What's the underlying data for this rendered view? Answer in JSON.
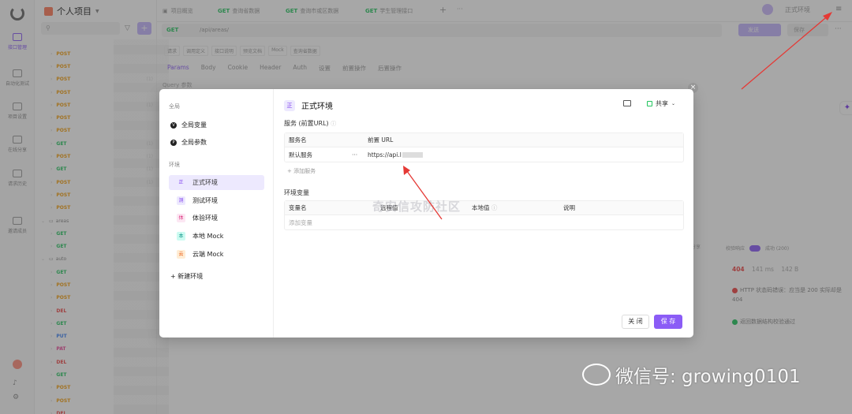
{
  "app": {
    "project_title": "个人项目",
    "nav": [
      {
        "label": "接口管理"
      },
      {
        "label": "自动化测试"
      },
      {
        "label": "项目设置"
      },
      {
        "label": "在线分享"
      },
      {
        "label": "请求历史"
      },
      {
        "label": "邀请成员"
      }
    ],
    "tree": [
      {
        "method": "POST",
        "cls": "m-post",
        "count": ""
      },
      {
        "method": "POST",
        "cls": "m-post",
        "count": ""
      },
      {
        "method": "POST",
        "cls": "m-post",
        "count": "(1)"
      },
      {
        "method": "POST",
        "cls": "m-post",
        "count": ""
      },
      {
        "method": "POST",
        "cls": "m-post",
        "count": "(1)"
      },
      {
        "method": "POST",
        "cls": "m-post",
        "count": ""
      },
      {
        "method": "POST",
        "cls": "m-post",
        "count": ""
      },
      {
        "method": "GET",
        "cls": "m-get",
        "count": "(1)"
      },
      {
        "method": "POST",
        "cls": "m-post",
        "count": "(1)"
      },
      {
        "method": "GET",
        "cls": "m-get",
        "count": "(1)"
      },
      {
        "method": "POST",
        "cls": "m-post",
        "count": "(1)"
      },
      {
        "method": "POST",
        "cls": "m-post",
        "count": ""
      },
      {
        "method": "POST",
        "cls": "m-post",
        "count": ""
      },
      {
        "folder": "areas"
      },
      {
        "method": "GET",
        "cls": "m-get",
        "count": ""
      },
      {
        "method": "GET",
        "cls": "m-get",
        "count": ""
      },
      {
        "folder": "auto"
      },
      {
        "method": "GET",
        "cls": "m-get",
        "count": ""
      },
      {
        "method": "POST",
        "cls": "m-post",
        "count": ""
      },
      {
        "method": "POST",
        "cls": "m-post",
        "count": ""
      },
      {
        "method": "DEL",
        "cls": "m-del",
        "count": ""
      },
      {
        "method": "GET",
        "cls": "m-get",
        "count": ""
      },
      {
        "method": "PUT",
        "cls": "m-put",
        "count": ""
      },
      {
        "method": "PAT",
        "cls": "m-pat",
        "count": ""
      },
      {
        "method": "DEL",
        "cls": "m-del",
        "count": ""
      },
      {
        "method": "GET",
        "cls": "m-get",
        "count": ""
      },
      {
        "method": "POST",
        "cls": "m-post",
        "count": ""
      },
      {
        "method": "POST",
        "cls": "m-post",
        "count": ""
      },
      {
        "method": "DEL",
        "cls": "m-del",
        "count": ""
      }
    ],
    "tabs": [
      {
        "method": "",
        "label": "项目概览"
      },
      {
        "method": "GET",
        "label": "查询省数据"
      },
      {
        "method": "GET",
        "label": "查询市或区数据"
      },
      {
        "method": "GET",
        "label": "学生管理接口"
      }
    ],
    "env_current": "正式环境",
    "url_method": "GET",
    "url_path": "/api/areas/",
    "send_label": "发送",
    "save_label": "保存",
    "subbar": [
      "请求",
      "调用定义",
      "接口说明",
      "预览文档",
      "Mock",
      "查询省数据"
    ],
    "param_tabs": [
      "Params",
      "Body",
      "Cookie",
      "Header",
      "Auth",
      "设置",
      "前置操作",
      "后置操作"
    ],
    "query_params_label": "Query 参数",
    "share_mini": "分享",
    "right_pane": {
      "validate_label": "校验响应",
      "success_label": "成功 (200)",
      "status": "404",
      "time": "141 ms",
      "size": "142 B",
      "error_text": "HTTP 状态码错误：应当是 200 实际却是 404",
      "ok_text": "返回数据结构校验通过"
    }
  },
  "modal": {
    "global_label": "全局",
    "global_vars": "全局变量",
    "global_params": "全局参数",
    "env_label": "环境",
    "environments": [
      {
        "badge": "正",
        "label": "正式环境",
        "bg": "#ede9fe",
        "fg": "#7c3aed",
        "active": true
      },
      {
        "badge": "测",
        "label": "测试环境",
        "bg": "#ede9fe",
        "fg": "#7c3aed",
        "active": false
      },
      {
        "badge": "体",
        "label": "体验环境",
        "bg": "#fce7f3",
        "fg": "#db2777",
        "active": false
      },
      {
        "badge": "本",
        "label": "本地 Mock",
        "bg": "#ccfbf1",
        "fg": "#0d9488",
        "active": false
      },
      {
        "badge": "云",
        "label": "云端 Mock",
        "bg": "#ffedd5",
        "fg": "#ea580c",
        "active": false
      }
    ],
    "new_env": "+ 新建环境",
    "title_badge": "正",
    "title": "正式环境",
    "share": "共享",
    "service_label": "服务 (前置URL)",
    "svc_headers": [
      "服务名",
      "前置 URL"
    ],
    "svc_row": {
      "name": "默认服务",
      "url": "https://api.l"
    },
    "add_service": "+ 添加服务",
    "envvar_label": "环境变量",
    "var_headers": [
      "变量名",
      "远程值",
      "本地值",
      "说明"
    ],
    "add_var": "添加变量",
    "close": "关 闭",
    "save": "保 存"
  },
  "watermark": "奇安信攻防社区",
  "wechat": "微信号: growing0101"
}
